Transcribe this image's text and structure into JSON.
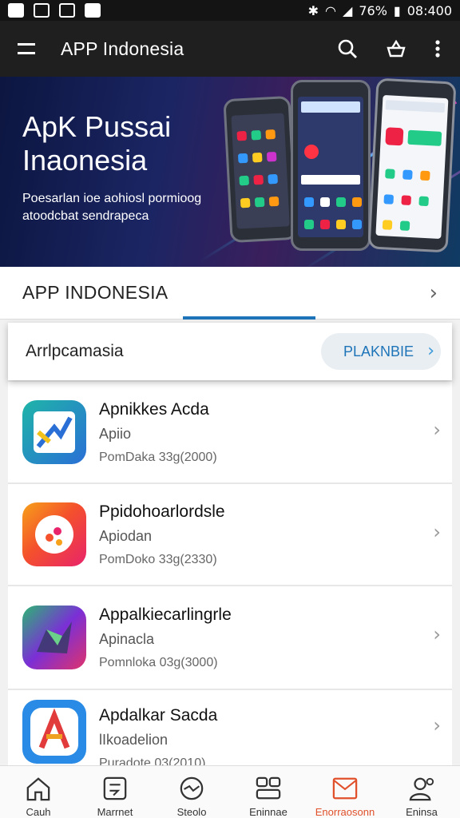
{
  "status_bar": {
    "battery": "76%",
    "time": "08:400"
  },
  "app_bar": {
    "title": "APP Indonesia"
  },
  "hero": {
    "title_line1": "ApK Pussai",
    "title_line2": "Inaonesia",
    "subtitle": "Poesarlan ioe aohiosl pormioog atoodcbat sendrapeca"
  },
  "section": {
    "title": "APP INDONESIA",
    "arrow": "›"
  },
  "filter": {
    "label": "Arrlpcamasia",
    "button": "PLAKNBIE",
    "button_arrow": "›"
  },
  "apps": [
    {
      "name": "Apnikkes Acda",
      "category": "Apiio",
      "meta": "PomDaka 33g(2000)",
      "colors": [
        "#1fb5a8",
        "#2a6fd6",
        "#f2c21b"
      ]
    },
    {
      "name": "Ppidohoarlordsle",
      "category": "Apiodan",
      "meta": "PomDoko 33g(2330)",
      "colors": [
        "#f4512c",
        "#e8236a",
        "#f7a11a"
      ]
    },
    {
      "name": "Appalkiecarlingrle",
      "category": "Apinacla",
      "meta": "Pomnloka 03g(3000)",
      "colors": [
        "#7b2fd6",
        "#e0336b",
        "#2bb673"
      ]
    },
    {
      "name": "Apdalkar Sacda",
      "category": "lIkoadelion",
      "meta": "Puradote 03(2010)",
      "colors": [
        "#2a8be6",
        "#f0a020",
        "#e23b3b"
      ]
    }
  ],
  "bottom_nav": [
    {
      "label": "Cauh",
      "icon": "home-icon"
    },
    {
      "label": "Marrnet",
      "icon": "message-icon"
    },
    {
      "label": "Steolo",
      "icon": "compass-icon"
    },
    {
      "label": "Eninnae",
      "icon": "grid-icon"
    },
    {
      "label": "Enorraosonn",
      "icon": "mail-icon",
      "active": true
    },
    {
      "label": "Eninsa",
      "icon": "user-icon"
    }
  ],
  "colors": {
    "accent": "#1e74b8",
    "active_nav": "#e0502a",
    "app_bar": "#1f1f1f"
  }
}
